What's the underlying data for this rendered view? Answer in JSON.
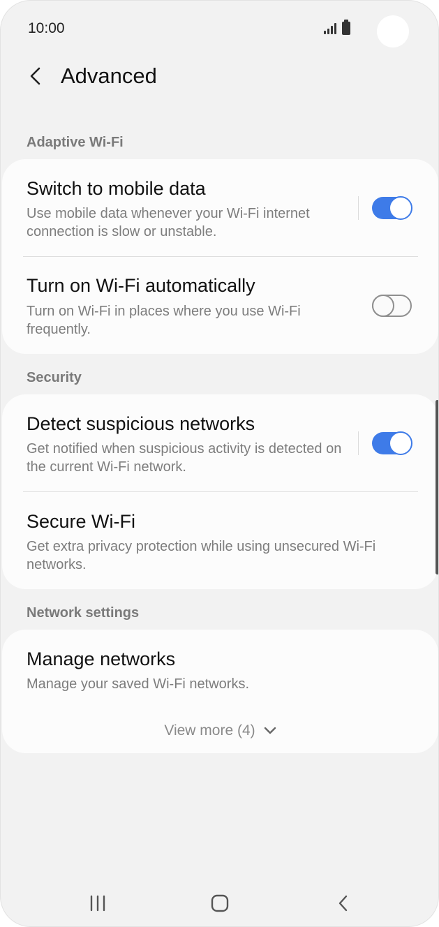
{
  "status_bar": {
    "time": "10:00"
  },
  "header": {
    "title": "Advanced",
    "back_icon": "chevron-left-icon"
  },
  "sections": {
    "adaptive_wifi": {
      "header": "Adaptive Wi-Fi",
      "switch_to_mobile_data": {
        "title": "Switch to mobile data",
        "subtitle": "Use mobile data whenever your Wi-Fi internet connection is slow or unstable.",
        "enabled": true
      },
      "turn_on_wifi_automatically": {
        "title": "Turn on Wi-Fi automatically",
        "subtitle": "Turn on Wi-Fi in places where you use Wi-Fi frequently.",
        "enabled": false
      }
    },
    "security": {
      "header": "Security",
      "detect_suspicious_networks": {
        "title": "Detect suspicious networks",
        "subtitle": "Get notified when suspicious activity is detected on the current Wi-Fi network.",
        "enabled": true
      },
      "secure_wifi": {
        "title": "Secure Wi-Fi",
        "subtitle": "Get extra privacy protection while using unsecured Wi-Fi networks."
      }
    },
    "network_settings": {
      "header": "Network settings",
      "manage_networks": {
        "title": "Manage networks",
        "subtitle": "Manage your saved Wi-Fi networks."
      },
      "view_more": "View more (4)"
    }
  },
  "nav_bar": {
    "recents_icon": "recents-icon",
    "home_icon": "home-icon",
    "back_icon": "back-icon"
  },
  "colors": {
    "accent": "#3e7be8",
    "background": "#f2f2f2",
    "card": "#fcfcfc",
    "secondary_text": "#7d7d7d"
  }
}
